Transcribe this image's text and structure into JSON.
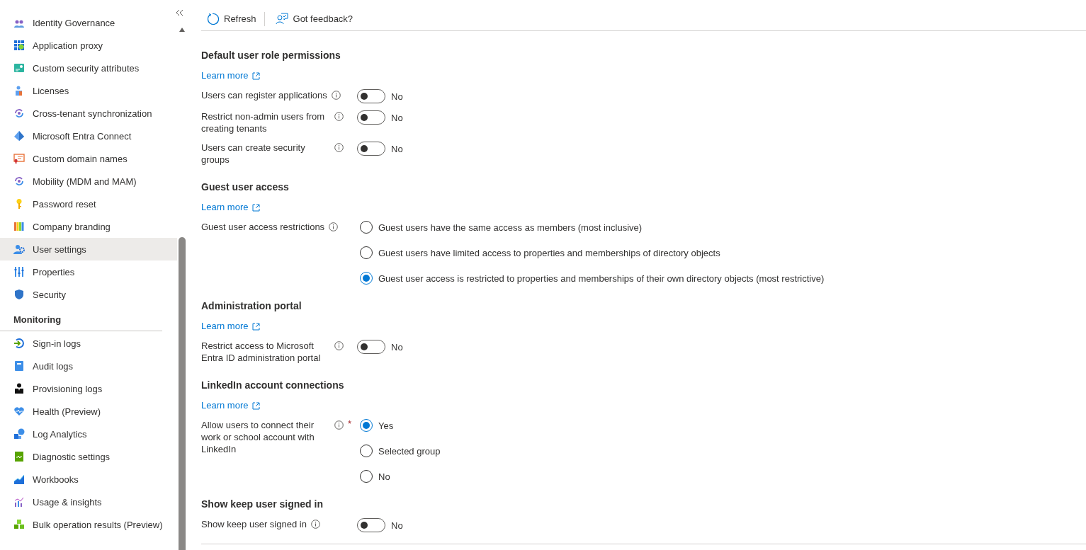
{
  "sidebar": {
    "groups": [
      {
        "items": [
          {
            "label": "Identity Governance",
            "selected": false
          },
          {
            "label": "Application proxy",
            "selected": false
          },
          {
            "label": "Custom security attributes",
            "selected": false
          },
          {
            "label": "Licenses",
            "selected": false
          },
          {
            "label": "Cross-tenant synchronization",
            "selected": false
          },
          {
            "label": "Microsoft Entra Connect",
            "selected": false
          },
          {
            "label": "Custom domain names",
            "selected": false
          },
          {
            "label": "Mobility (MDM and MAM)",
            "selected": false
          },
          {
            "label": "Password reset",
            "selected": false
          },
          {
            "label": "Company branding",
            "selected": false
          },
          {
            "label": "User settings",
            "selected": true
          },
          {
            "label": "Properties",
            "selected": false
          },
          {
            "label": "Security",
            "selected": false
          }
        ]
      },
      {
        "heading": "Monitoring",
        "items": [
          {
            "label": "Sign-in logs",
            "selected": false
          },
          {
            "label": "Audit logs",
            "selected": false
          },
          {
            "label": "Provisioning logs",
            "selected": false
          },
          {
            "label": "Health (Preview)",
            "selected": false
          },
          {
            "label": "Log Analytics",
            "selected": false
          },
          {
            "label": "Diagnostic settings",
            "selected": false
          },
          {
            "label": "Workbooks",
            "selected": false
          },
          {
            "label": "Usage & insights",
            "selected": false
          },
          {
            "label": "Bulk operation results (Preview)",
            "selected": false
          }
        ]
      }
    ]
  },
  "toolbar": {
    "buttons": [
      {
        "label": "Refresh"
      },
      {
        "label": "Got feedback?"
      }
    ]
  },
  "sections": [
    {
      "title": "Default user role permissions",
      "learn_more": "Learn more",
      "settings": [
        {
          "kind": "toggle",
          "label": "Users can register applications",
          "on": false,
          "value_text": "No"
        },
        {
          "kind": "toggle",
          "label": "Restrict non-admin users from creating tenants",
          "on": false,
          "value_text": "No"
        },
        {
          "kind": "toggle",
          "label": "Users can create security groups",
          "on": false,
          "value_text": "No"
        }
      ]
    },
    {
      "title": "Guest user access",
      "learn_more": "Learn more",
      "settings": [
        {
          "kind": "radio",
          "label": "Guest user access restrictions",
          "options": [
            {
              "label": "Guest users have the same access as members (most inclusive)",
              "selected": false
            },
            {
              "label": "Guest users have limited access to properties and memberships of directory objects",
              "selected": false
            },
            {
              "label": "Guest user access is restricted to properties and memberships of their own directory objects (most restrictive)",
              "selected": true
            }
          ]
        }
      ]
    },
    {
      "title": "Administration portal",
      "learn_more": "Learn more",
      "settings": [
        {
          "kind": "toggle",
          "label": "Restrict access to Microsoft Entra ID administration portal",
          "on": false,
          "value_text": "No"
        }
      ]
    },
    {
      "title": "LinkedIn account connections",
      "learn_more": "Learn more",
      "settings": [
        {
          "kind": "radio",
          "label": "Allow users to connect their work or school account with LinkedIn",
          "required_mark": "*",
          "options": [
            {
              "label": "Yes",
              "selected": true
            },
            {
              "label": "Selected group",
              "selected": false
            },
            {
              "label": "No",
              "selected": false
            }
          ]
        }
      ]
    },
    {
      "title": "Show keep user signed in",
      "settings": [
        {
          "kind": "toggle",
          "label": "Show keep user signed in",
          "on": false,
          "value_text": "No"
        }
      ]
    }
  ]
}
